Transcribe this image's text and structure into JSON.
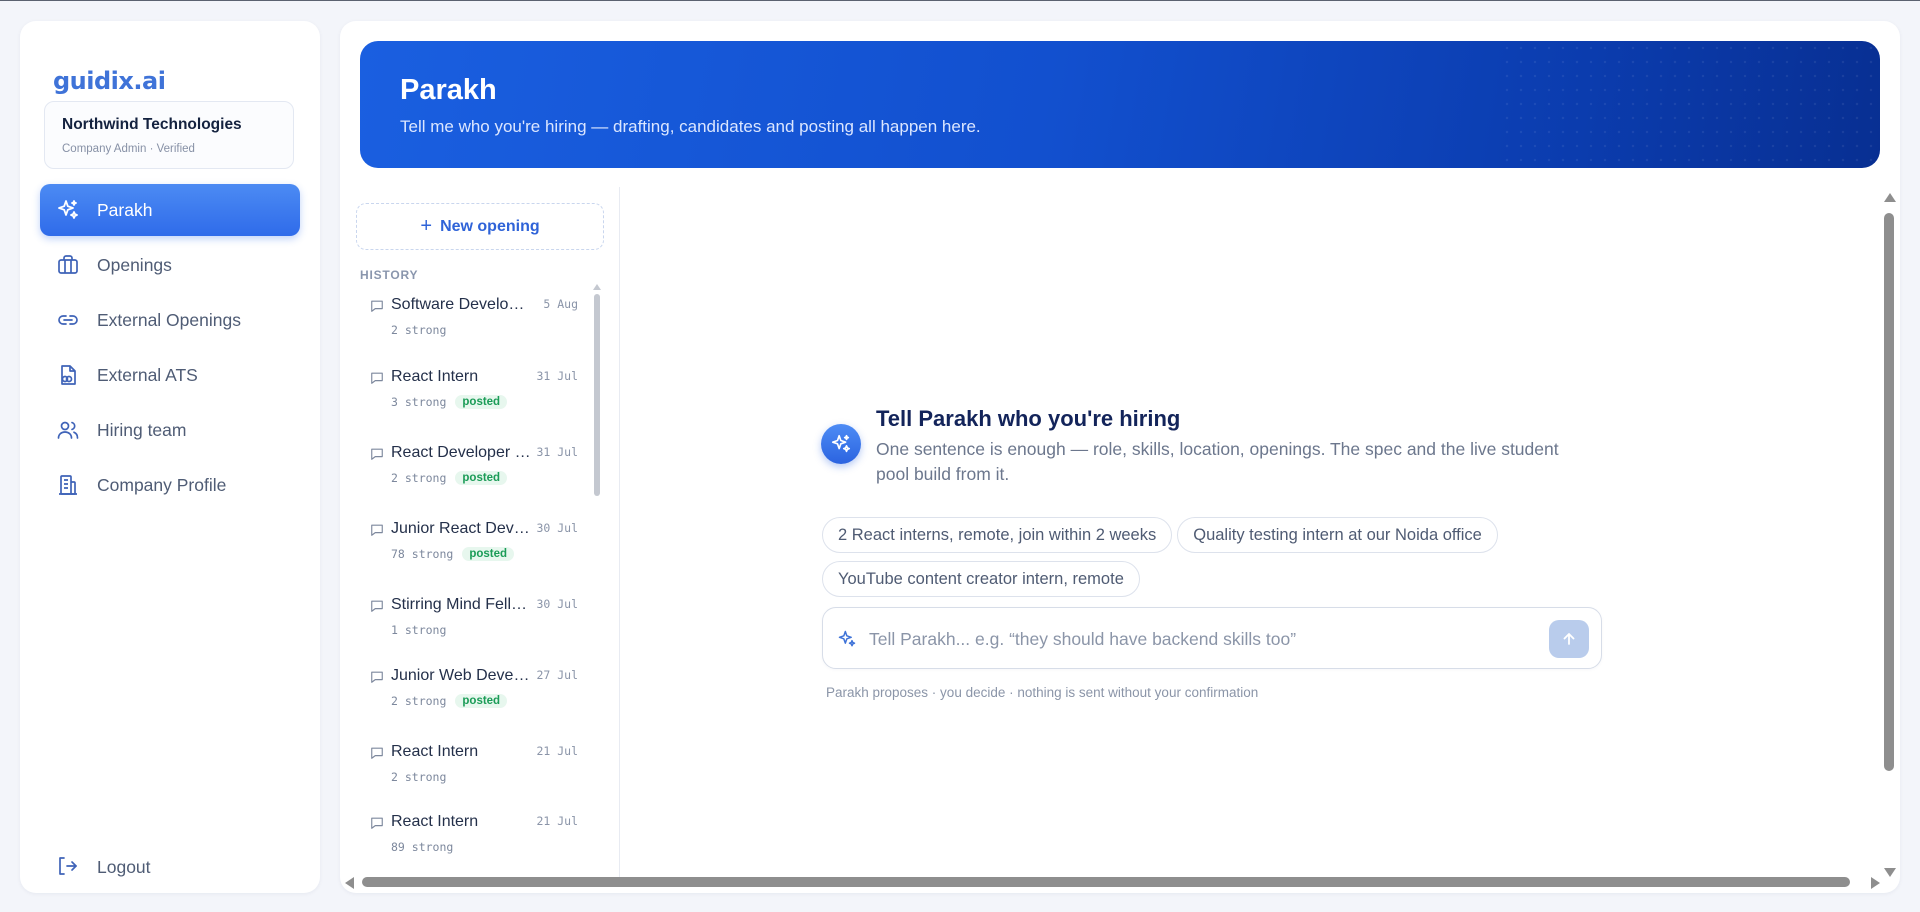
{
  "brand": {
    "logo": "guidix.ai"
  },
  "company": {
    "name": "Northwind Technologies",
    "meta": "Company Admin · Verified"
  },
  "nav": {
    "items": [
      {
        "label": "Parakh",
        "icon": "sparkle-icon",
        "active": true
      },
      {
        "label": "Openings",
        "icon": "briefcase-icon"
      },
      {
        "label": "External Openings",
        "icon": "link-icon"
      },
      {
        "label": "External ATS",
        "icon": "document-link-icon"
      },
      {
        "label": "Hiring team",
        "icon": "users-icon"
      },
      {
        "label": "Company Profile",
        "icon": "building-icon"
      }
    ],
    "logout": "Logout"
  },
  "hero": {
    "title": "Parakh",
    "subtitle": "Tell me who you're hiring — drafting, candidates and posting all happen here."
  },
  "history": {
    "new_opening": "New opening",
    "label": "HISTORY",
    "items": [
      {
        "title": "Software Development Intern",
        "date": "5 Aug",
        "strong": "2 strong",
        "badge": ""
      },
      {
        "title": "React Intern",
        "date": "31 Jul",
        "strong": "3 strong",
        "badge": "posted"
      },
      {
        "title": "React Developer Intern",
        "date": "31 Jul",
        "strong": "2 strong",
        "badge": "posted"
      },
      {
        "title": "Junior React Developer",
        "date": "30 Jul",
        "strong": "78 strong",
        "badge": "posted"
      },
      {
        "title": "Stirring Mind Fellowship",
        "date": "30 Jul",
        "strong": "1 strong",
        "badge": ""
      },
      {
        "title": "Junior Web Developer",
        "date": "27 Jul",
        "strong": "2 strong",
        "badge": "posted"
      },
      {
        "title": "React Intern",
        "date": "21 Jul",
        "strong": "2 strong",
        "badge": ""
      },
      {
        "title": "React Intern",
        "date": "21 Jul",
        "strong": "89 strong",
        "badge": ""
      }
    ]
  },
  "chat": {
    "intro_title": "Tell Parakh who you're hiring",
    "intro_subtitle": "One sentence is enough — role, skills, location, openings. The spec and the live student pool build from it.",
    "suggestions": [
      "2 React interns, remote, join within 2 weeks",
      "Quality testing intern at our Noida office",
      "YouTube content creator intern, remote"
    ],
    "input_placeholder": "Tell Parakh... e.g. “they should have backend skills too”",
    "input_value": "",
    "disclaimer": "Parakh proposes · you decide · nothing is sent without your confirmation"
  },
  "colors": {
    "accent": "#2f6bea",
    "hero_start": "#1a5fe0",
    "hero_end": "#082f92",
    "posted_badge_bg": "#e7f7ee",
    "posted_badge_text": "#1b9c57"
  }
}
